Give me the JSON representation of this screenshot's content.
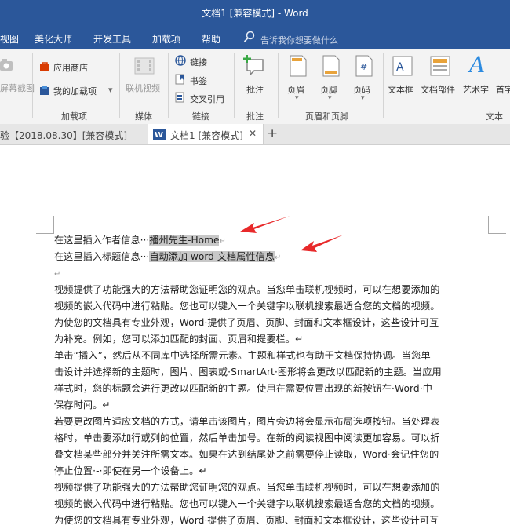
{
  "window": {
    "title": "文档1 [兼容模式]  -  Word"
  },
  "menu": {
    "items": [
      "视图",
      "美化大师",
      "开发工具",
      "加载项",
      "帮助"
    ],
    "search_placeholder": "告诉我你想要做什么"
  },
  "ribbon": {
    "screenshot": "屏幕截图",
    "app_store": "应用商店",
    "my_addins": "我的加载项",
    "addins_group": "加载项",
    "online_video": "联机视频",
    "media_group": "媒体",
    "link": "链接",
    "bookmark": "书签",
    "cross_ref": "交叉引用",
    "links_group": "链接",
    "comment": "批注",
    "comment_group": "批注",
    "header": "页眉",
    "footer": "页脚",
    "page_number": "页码",
    "header_footer_group": "页眉和页脚",
    "text_box": "文本框",
    "doc_parts": "文档部件",
    "wordart": "艺术字",
    "dropcap": "首字",
    "text_group": "文本"
  },
  "tabs": {
    "prev": "验【2018.08.30】[兼容模式]",
    "active": "文档1 [兼容模式]",
    "close": "✕",
    "add": "+"
  },
  "doc": {
    "line1_label": "在这里插入作者信息···",
    "line1_value": "播州先生-Home",
    "line2_label": "在这里插入标题信息···",
    "line2_value": "自动添加 word 文档属性信息",
    "paragraphs": [
      "视频提供了功能强大的方法帮助您证明您的观点。当您单击联机视频时，可以在想要添加的",
      "视频的嵌入代码中进行粘贴。您也可以键入一个关键字以联机搜索最适合您的文档的视频。",
      "为使您的文档具有专业外观，Word·提供了页眉、页脚、封面和文本框设计，这些设计可互",
      "为补充。例如，您可以添加匹配的封面、页眉和提要栏。↵",
      "单击“插入”，然后从不同库中选择所需元素。主题和样式也有助于文档保持协调。当您单",
      "击设计并选择新的主题时，图片、图表或·SmartArt·图形将会更改以匹配新的主题。当应用",
      "样式时，您的标题会进行更改以匹配新的主题。使用在需要位置出现的新按钮在·Word·中",
      "保存时间。↵",
      "若要更改图片适应文档的方式，请单击该图片，图片旁边将会显示布局选项按钮。当处理表",
      "格时，单击要添加行或列的位置，然后单击加号。在新的阅读视图中阅读更加容易。可以折",
      "叠文档某些部分并关注所需文本。如果在达到结尾处之前需要停止读取，Word·会记住您的",
      "停止位置·-·即使在另一个设备上。↵",
      "视频提供了功能强大的方法帮助您证明您的观点。当您单击联机视频时，可以在想要添加的",
      "视频的嵌入代码中进行粘贴。您也可以键入一个关键字以联机搜索最适合您的文档的视频。",
      "为使您的文档具有专业外观，Word·提供了页眉、页脚、封面和文本框设计，这些设计可互"
    ]
  }
}
